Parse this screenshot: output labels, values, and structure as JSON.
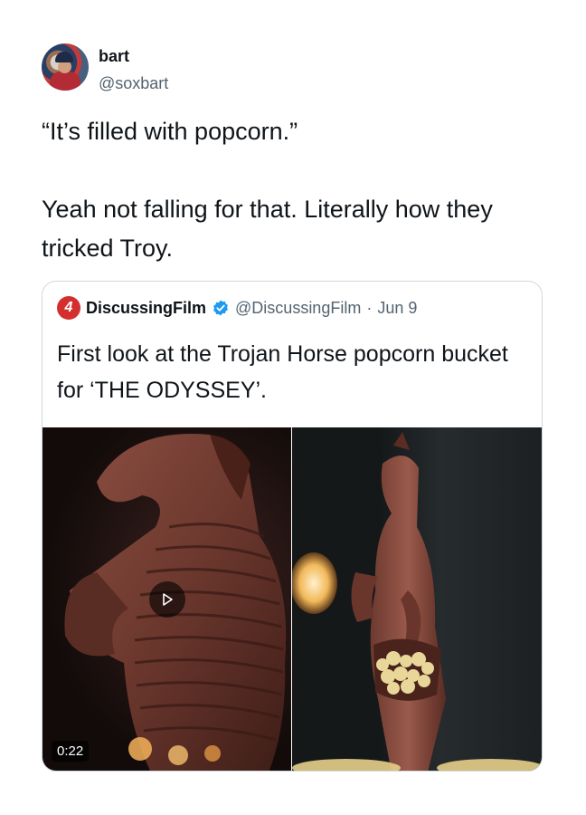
{
  "author": {
    "name": "bart",
    "handle": "@soxbart"
  },
  "tweet": {
    "text": "“It’s filled with popcorn.”\n\nYeah not falling for that. Literally how they tricked Troy."
  },
  "quoted_tweet": {
    "name": "DiscussingFilm",
    "handle": "@DiscussingFilm",
    "separator": "·",
    "date": "Jun 9",
    "logo_text": "4",
    "text": "First look at the Trojan Horse popcorn bucket for ‘THE ODYSSEY’.",
    "media": {
      "duration": "0:22",
      "icons": [
        "play-icon",
        "verified-badge-icon"
      ]
    }
  },
  "colors": {
    "text": "#0f1419",
    "secondary": "#536471",
    "border": "#cfd9de",
    "verified": "#1d9bf0",
    "brand_logo": "#d42f2f"
  }
}
